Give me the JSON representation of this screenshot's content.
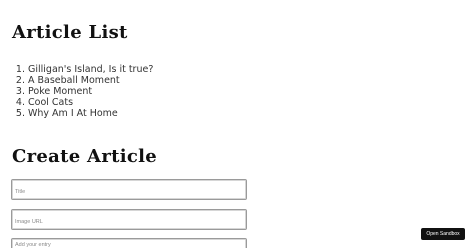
{
  "article_list": {
    "heading": "Article List",
    "items": [
      {
        "label": "Gilligan's Island, Is it true?"
      },
      {
        "label": "A Baseball Moment"
      },
      {
        "label": "Poke Moment"
      },
      {
        "label": "Cool Cats"
      },
      {
        "label": "Why Am I At Home"
      }
    ]
  },
  "create_article": {
    "heading": "Create Article",
    "title_placeholder": "Title",
    "image_url_placeholder": "Image URL",
    "entry_placeholder": "Add your entry"
  },
  "sandbox": {
    "button_label": "Open Sandbox"
  }
}
